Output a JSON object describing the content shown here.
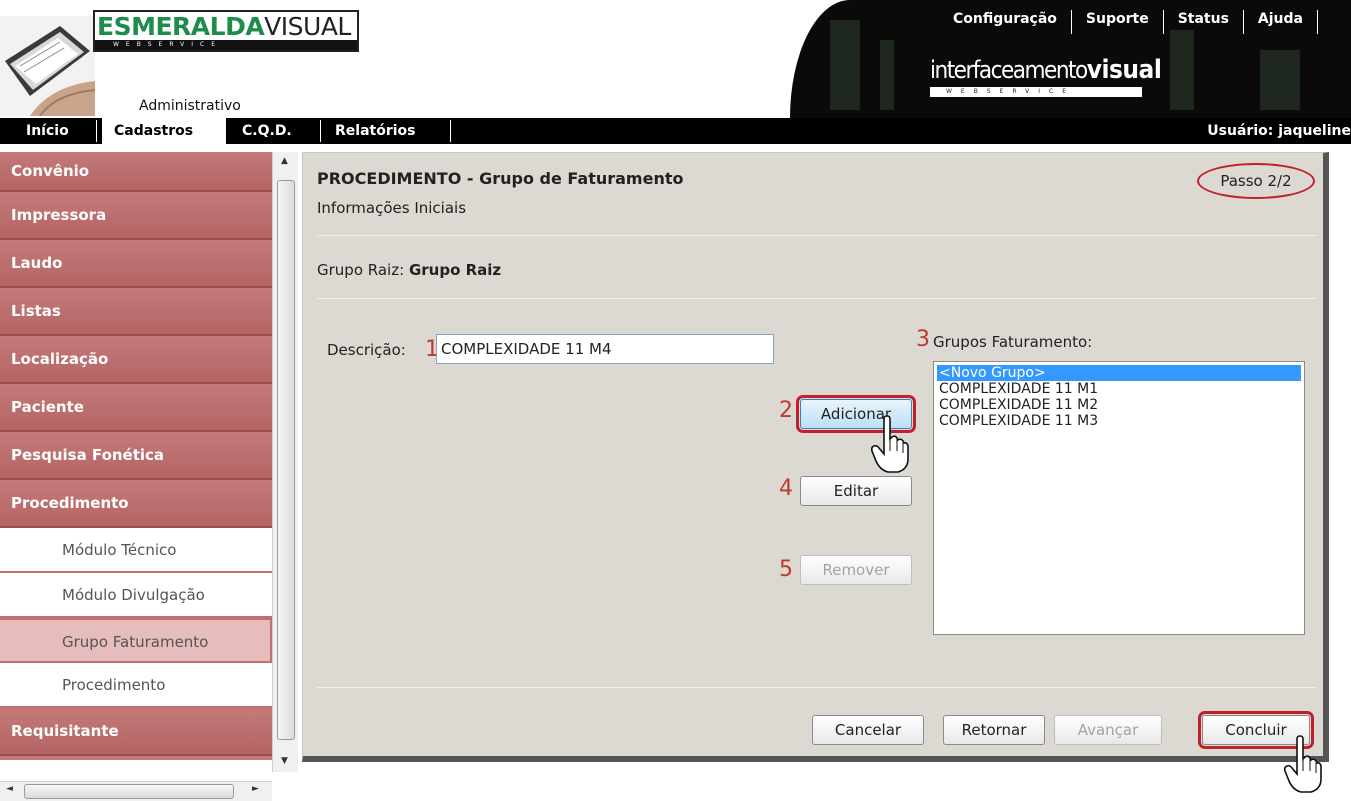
{
  "header": {
    "brand_part1": "ESMERALDA",
    "brand_part2": "VISUAL",
    "brand_strip": "WEBSERVICE",
    "subtitle": "Administrativo",
    "iv_logo_part1": "interfaceamento",
    "iv_logo_part2": "visual",
    "iv_strip": "WEBSERVICE",
    "top_links": [
      "Configuração",
      "Suporte",
      "Status",
      "Ajuda"
    ]
  },
  "mainnav": {
    "items": [
      "Início",
      "Cadastros",
      "C.Q.D.",
      "Relatórios"
    ],
    "active": "Cadastros",
    "user": "Usuário: jaqueline"
  },
  "sidebar": {
    "items": [
      {
        "label": "Convênio",
        "type": "category"
      },
      {
        "label": "Impressora",
        "type": "category"
      },
      {
        "label": "Laudo",
        "type": "category"
      },
      {
        "label": "Listas",
        "type": "category"
      },
      {
        "label": "Localização",
        "type": "category"
      },
      {
        "label": "Paciente",
        "type": "category"
      },
      {
        "label": "Pesquisa Fonética",
        "type": "category"
      },
      {
        "label": "Procedimento",
        "type": "category"
      },
      {
        "label": "Módulo Técnico",
        "type": "sub"
      },
      {
        "label": "Módulo Divulgação",
        "type": "sub"
      },
      {
        "label": "Grupo Faturamento",
        "type": "sub",
        "selected": true
      },
      {
        "label": "Procedimento",
        "type": "sub"
      },
      {
        "label": "Requisitante",
        "type": "category"
      }
    ]
  },
  "panel": {
    "title": "PROCEDIMENTO - Grupo de Faturamento",
    "subtitle": "Informações Iniciais",
    "step": "Passo 2/2",
    "root_label": "Grupo Raiz:",
    "root_value": "Grupo Raiz",
    "description_label": "Descrição:",
    "description_value": "COMPLEXIDADE 11 M4",
    "groups_label": "Grupos Faturamento:",
    "groups": [
      "<Novo Grupo>",
      "COMPLEXIDADE 11 M1",
      "COMPLEXIDADE 11 M2",
      "COMPLEXIDADE 11 M3"
    ],
    "selected_group": "<Novo Grupo>",
    "buttons": {
      "add": "Adicionar",
      "edit": "Editar",
      "remove": "Remover",
      "cancel": "Cancelar",
      "back": "Retornar",
      "next": "Avançar",
      "finish": "Concluir"
    },
    "step_markers": [
      "1",
      "2",
      "3",
      "4",
      "5"
    ]
  },
  "colors": {
    "sidebar_category": "#b56464",
    "sidebar_selected": "#e6bcbc",
    "panel_bg": "#dcd8d2",
    "highlight": "#c0202a",
    "list_selection": "#3399ff",
    "brand_green": "#1d8c4c"
  }
}
